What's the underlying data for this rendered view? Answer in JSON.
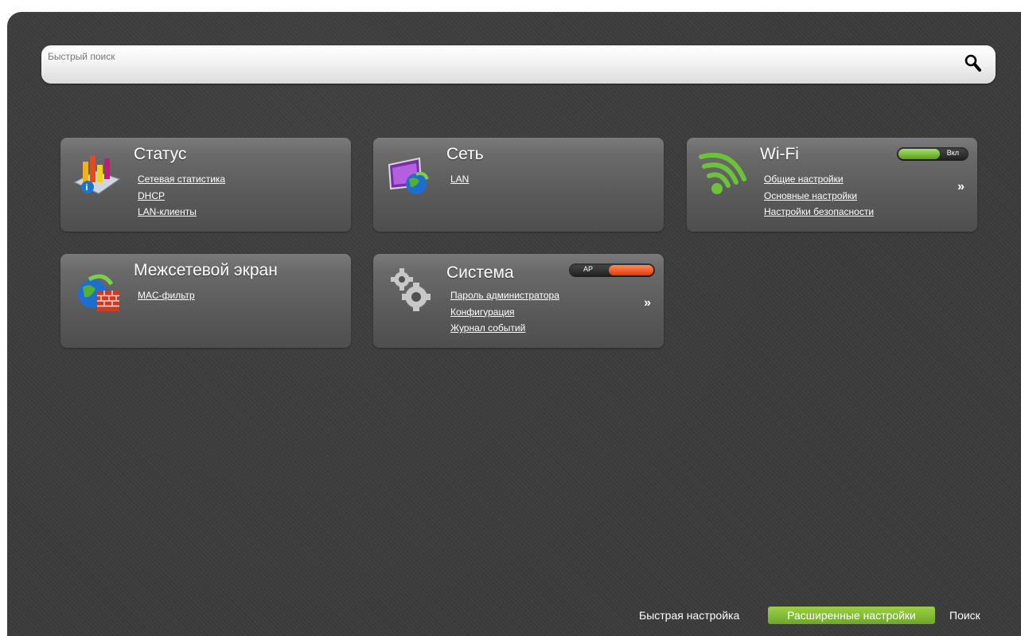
{
  "search": {
    "placeholder": "Быстрый поиск",
    "value": ""
  },
  "cards": {
    "status": {
      "title": "Статус",
      "links": [
        "Сетевая статистика",
        "DHCP",
        "LAN-клиенты"
      ]
    },
    "network": {
      "title": "Сеть",
      "links": [
        "LAN"
      ]
    },
    "wifi": {
      "title": "Wi-Fi",
      "toggle_label": "Вкл",
      "toggle_state": "on",
      "links": [
        "Общие настройки",
        "Основные настройки",
        "Настройки безопасности"
      ],
      "more": "»"
    },
    "firewall": {
      "title": "Межсетевой экран",
      "links": [
        "MAC-фильтр"
      ]
    },
    "system": {
      "title": "Система",
      "toggle_label": "AP",
      "toggle_state": "off",
      "links": [
        "Пароль администратора",
        "Конфигурация",
        "Журнал событий"
      ],
      "more": "»"
    }
  },
  "footer": {
    "quick_setup": "Быстрая настройка",
    "advanced": "Расширенные настройки",
    "search": "Поиск"
  },
  "colors": {
    "accent_green": "#7fba34",
    "toggle_red": "#e8461a",
    "background": "#3b3b3b"
  }
}
